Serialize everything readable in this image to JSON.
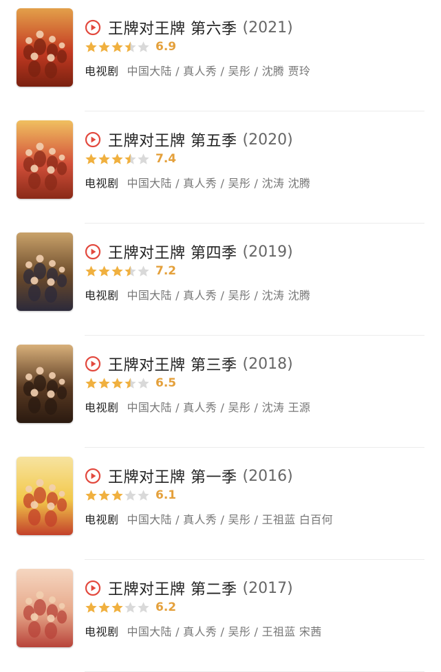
{
  "colors": {
    "accent_red": "#e2483d",
    "star_yellow": "#f0b03f",
    "star_grey": "#d9d9d9",
    "score_color": "#e4a03b"
  },
  "items": [
    {
      "title": "王牌对王牌 第六季",
      "year": "(2021)",
      "rating": 3.5,
      "score": "6.9",
      "type": "电视剧",
      "meta": "中国大陆 / 真人秀 / 吴彤 / 沈腾 贾玲",
      "poster_colors": [
        "#c43a22",
        "#e3a04a",
        "#7a2110"
      ]
    },
    {
      "title": "王牌对王牌 第五季",
      "year": "(2020)",
      "rating": 3.5,
      "score": "7.4",
      "type": "电视剧",
      "meta": "中国大陆 / 真人秀 / 吴彤 / 沈涛 沈腾",
      "poster_colors": [
        "#d3503a",
        "#f0c060",
        "#8a2a18"
      ]
    },
    {
      "title": "王牌对王牌 第四季",
      "year": "(2019)",
      "rating": 3.5,
      "score": "7.2",
      "type": "电视剧",
      "meta": "中国大陆 / 真人秀 / 吴彤 / 沈涛 沈腾",
      "poster_colors": [
        "#6b4a2a",
        "#c9a26a",
        "#2c2a3a"
      ]
    },
    {
      "title": "王牌对王牌 第三季",
      "year": "(2018)",
      "rating": 3.5,
      "score": "6.5",
      "type": "电视剧",
      "meta": "中国大陆 / 真人秀 / 吴彤 / 沈涛 王源",
      "poster_colors": [
        "#5a3a22",
        "#d8b07a",
        "#2a1a10"
      ]
    },
    {
      "title": "王牌对王牌 第一季",
      "year": "(2016)",
      "rating": 3,
      "score": "6.1",
      "type": "电视剧",
      "meta": "中国大陆 / 真人秀 / 吴彤 / 王祖蓝 白百何",
      "poster_colors": [
        "#f2c84a",
        "#f7e3a0",
        "#c3402a"
      ]
    },
    {
      "title": "王牌对王牌 第二季",
      "year": "(2017)",
      "rating": 3,
      "score": "6.2",
      "type": "电视剧",
      "meta": "中国大陆 / 真人秀 / 吴彤 / 王祖蓝 宋茜",
      "poster_colors": [
        "#e7a88a",
        "#f5d6c0",
        "#b8443a"
      ]
    }
  ]
}
